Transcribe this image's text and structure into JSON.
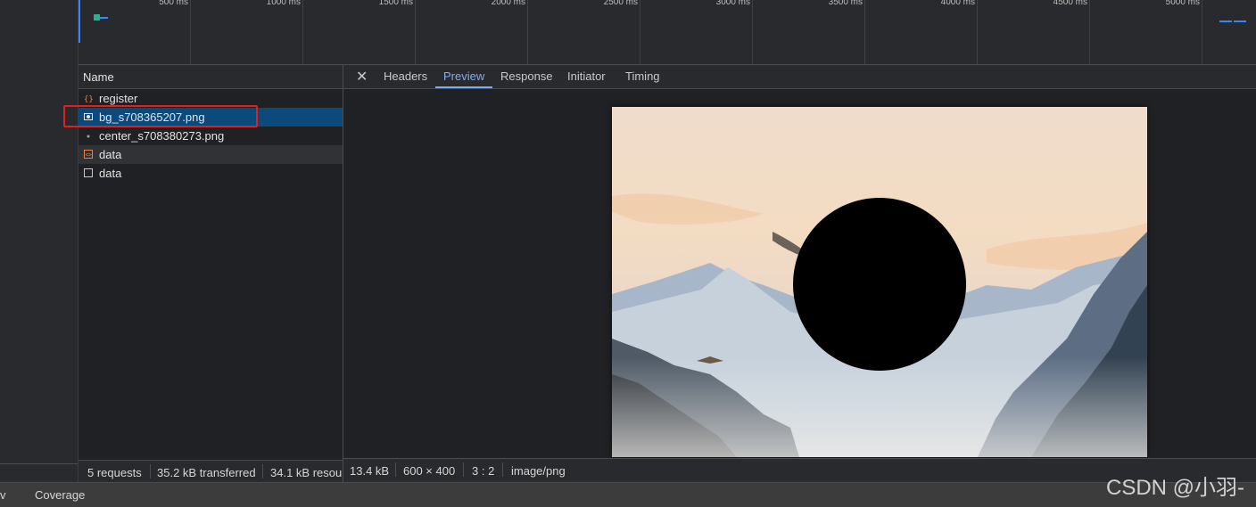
{
  "timeline": {
    "ticks": [
      "500 ms",
      "1000 ms",
      "1500 ms",
      "2000 ms",
      "2500 ms",
      "3000 ms",
      "3500 ms",
      "4000 ms",
      "4500 ms",
      "5000 ms"
    ]
  },
  "request_list": {
    "header": "Name",
    "rows": [
      {
        "label": "register",
        "icon": "code-braces-icon"
      },
      {
        "label": "bg_s708365207.png",
        "icon": "image-icon"
      },
      {
        "label": "center_s708380273.png",
        "icon": "dot-icon"
      },
      {
        "label": "data",
        "icon": "script-icon"
      },
      {
        "label": "data",
        "icon": "document-icon"
      }
    ],
    "status": {
      "requests": "5 requests",
      "transferred": "35.2 kB transferred",
      "resources": "34.1 kB resou"
    }
  },
  "preview": {
    "tabs": [
      "Headers",
      "Preview",
      "Response",
      "Initiator",
      "Timing"
    ],
    "active_tab": "Preview",
    "status": {
      "size": "13.4 kB",
      "dimensions": "600 × 400",
      "ratio": "3 : 2",
      "mime": "image/png"
    }
  },
  "drawer": {
    "left_partial": "v",
    "coverage": "Coverage"
  },
  "watermark": "CSDN @小羽-",
  "colors": {
    "selected_row": "#0b4a7a",
    "highlight_box": "#e0201c",
    "active_tab": "#7cacf8"
  }
}
